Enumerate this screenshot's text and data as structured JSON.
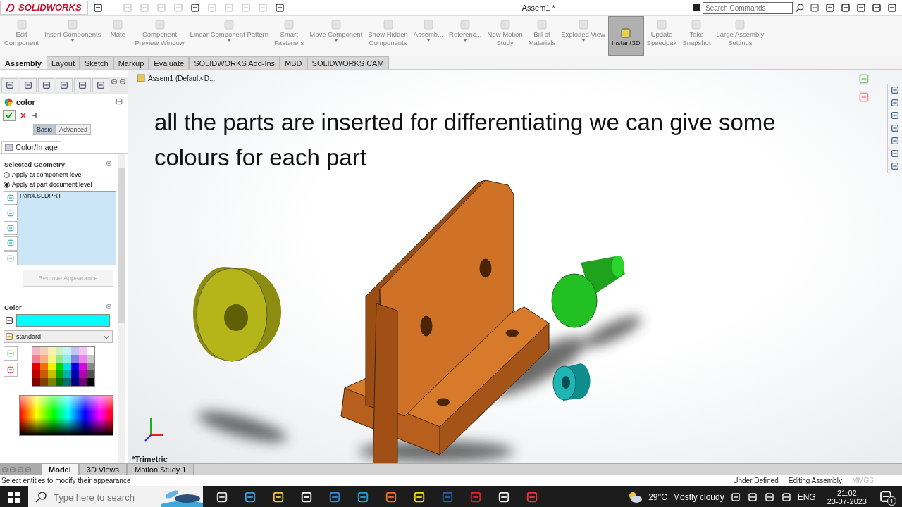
{
  "app": {
    "logo": "SOLIDWORKS"
  },
  "window": {
    "title": "Assem1 *"
  },
  "search": {
    "placeholder": "Search Commands"
  },
  "ribbon": [
    {
      "label": "Edit\nComponent",
      "disabled": true,
      "selected": false,
      "dropdown": false
    },
    {
      "label": "Insert Components",
      "disabled": true,
      "selected": false,
      "dropdown": true
    },
    {
      "label": "Mate",
      "disabled": true,
      "selected": false,
      "dropdown": false
    },
    {
      "label": "Component\nPreview Window",
      "disabled": true,
      "selected": false,
      "dropdown": false
    },
    {
      "label": "Linear Component Pattern",
      "disabled": true,
      "selected": false,
      "dropdown": true
    },
    {
      "label": "Smart\nFasteners",
      "disabled": true,
      "selected": false,
      "dropdown": false
    },
    {
      "label": "Move Component",
      "disabled": true,
      "selected": false,
      "dropdown": true
    },
    {
      "label": "Show Hidden\nComponents",
      "disabled": true,
      "selected": false,
      "dropdown": false
    },
    {
      "label": "Assemb...",
      "disabled": true,
      "selected": false,
      "dropdown": true
    },
    {
      "label": "Referenc...",
      "disabled": true,
      "selected": false,
      "dropdown": true
    },
    {
      "label": "New Motion\nStudy",
      "disabled": true,
      "selected": false,
      "dropdown": false
    },
    {
      "label": "Bill of\nMaterials",
      "disabled": true,
      "selected": false,
      "dropdown": false
    },
    {
      "label": "Exploded View",
      "disabled": true,
      "selected": false,
      "dropdown": true
    },
    {
      "label": "Instant3D",
      "disabled": false,
      "selected": true,
      "dropdown": false
    },
    {
      "label": "Update\nSpeedpak",
      "disabled": true,
      "selected": false,
      "dropdown": false
    },
    {
      "label": "Take\nSnapshot",
      "disabled": true,
      "selected": false,
      "dropdown": false
    },
    {
      "label": "Large Assembly\nSettings",
      "disabled": true,
      "selected": false,
      "dropdown": false
    }
  ],
  "tabs": [
    {
      "label": "Assembly",
      "selected": true
    },
    {
      "label": "Layout",
      "selected": false
    },
    {
      "label": "Sketch",
      "selected": false
    },
    {
      "label": "Markup",
      "selected": false
    },
    {
      "label": "Evaluate",
      "selected": false
    },
    {
      "label": "SOLIDWORKS Add-Ins",
      "selected": false
    },
    {
      "label": "MBD",
      "selected": false
    },
    {
      "label": "SOLIDWORKS CAM",
      "selected": false
    }
  ],
  "tree": {
    "root": "Assem1  (Default<D..."
  },
  "caption": "all the parts are inserted for differentiating we can give some colours for each part",
  "view": {
    "orientation": "*Trimetric"
  },
  "panel": {
    "title": "color",
    "modes": [
      {
        "label": "Basic",
        "selected": true
      },
      {
        "label": "Advanced",
        "selected": false
      }
    ],
    "tab": "Color/Image",
    "geometry": {
      "title": "Selected Geometry",
      "options": [
        {
          "label": "Apply at component level",
          "selected": false
        },
        {
          "label": "Apply at part document level",
          "selected": true
        }
      ],
      "items": [
        "Part4.SLDPRT"
      ],
      "remove_button": {
        "label": "Remove Appearance",
        "disabled": true
      }
    },
    "color": {
      "title": "Color",
      "color": "#00ffff",
      "palette": "standard"
    }
  },
  "bottom_tabs": [
    {
      "label": "Model",
      "selected": true
    },
    {
      "label": "3D Views",
      "selected": false
    },
    {
      "label": "Motion Study 1",
      "selected": false
    }
  ],
  "status_bar": {
    "message": "Select entities to modify their appearance",
    "fields": [
      "Under Defined",
      "Editing Assembly",
      "MMGS"
    ]
  },
  "taskbar": {
    "search_placeholder": "Type here to search",
    "weather": {
      "temp": "29°C",
      "text": "Mostly cloudy"
    },
    "language": "ENG",
    "time": "21:02",
    "date": "23-07-2023",
    "notifications": "1"
  }
}
